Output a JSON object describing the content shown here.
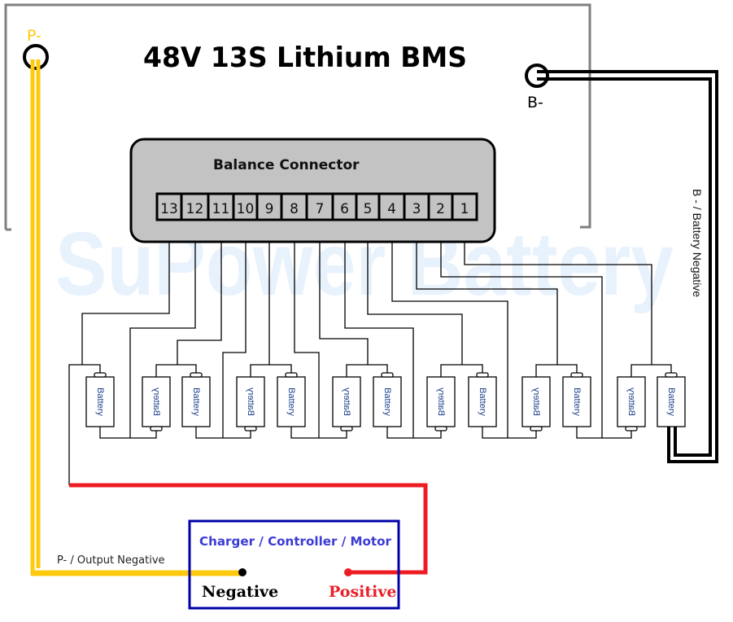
{
  "title": "48V 13S Lithium BMS",
  "watermark": "SuPower Battery",
  "terminals": {
    "p_minus": "P-",
    "b_minus": "B-"
  },
  "balance_connector": {
    "title": "Balance Connector",
    "pins": [
      "13",
      "12",
      "11",
      "10",
      "9",
      "8",
      "7",
      "6",
      "5",
      "4",
      "3",
      "2",
      "1"
    ]
  },
  "battery_label": "Battery",
  "battery_count": 13,
  "wire_labels": {
    "b_side": "B - / Battery Negative",
    "p_output": "P- / Output Negative"
  },
  "load": {
    "title": "Charger / Controller / Motor",
    "negative": "Negative",
    "positive": "Positive"
  },
  "colors": {
    "p_wire": "#ffc90e",
    "positive_wire": "#ed1c24",
    "b_wire": "#000000",
    "load_border": "#0000a8",
    "connector_fill": "#c3c3c3",
    "frame": "#7f7f7f"
  }
}
